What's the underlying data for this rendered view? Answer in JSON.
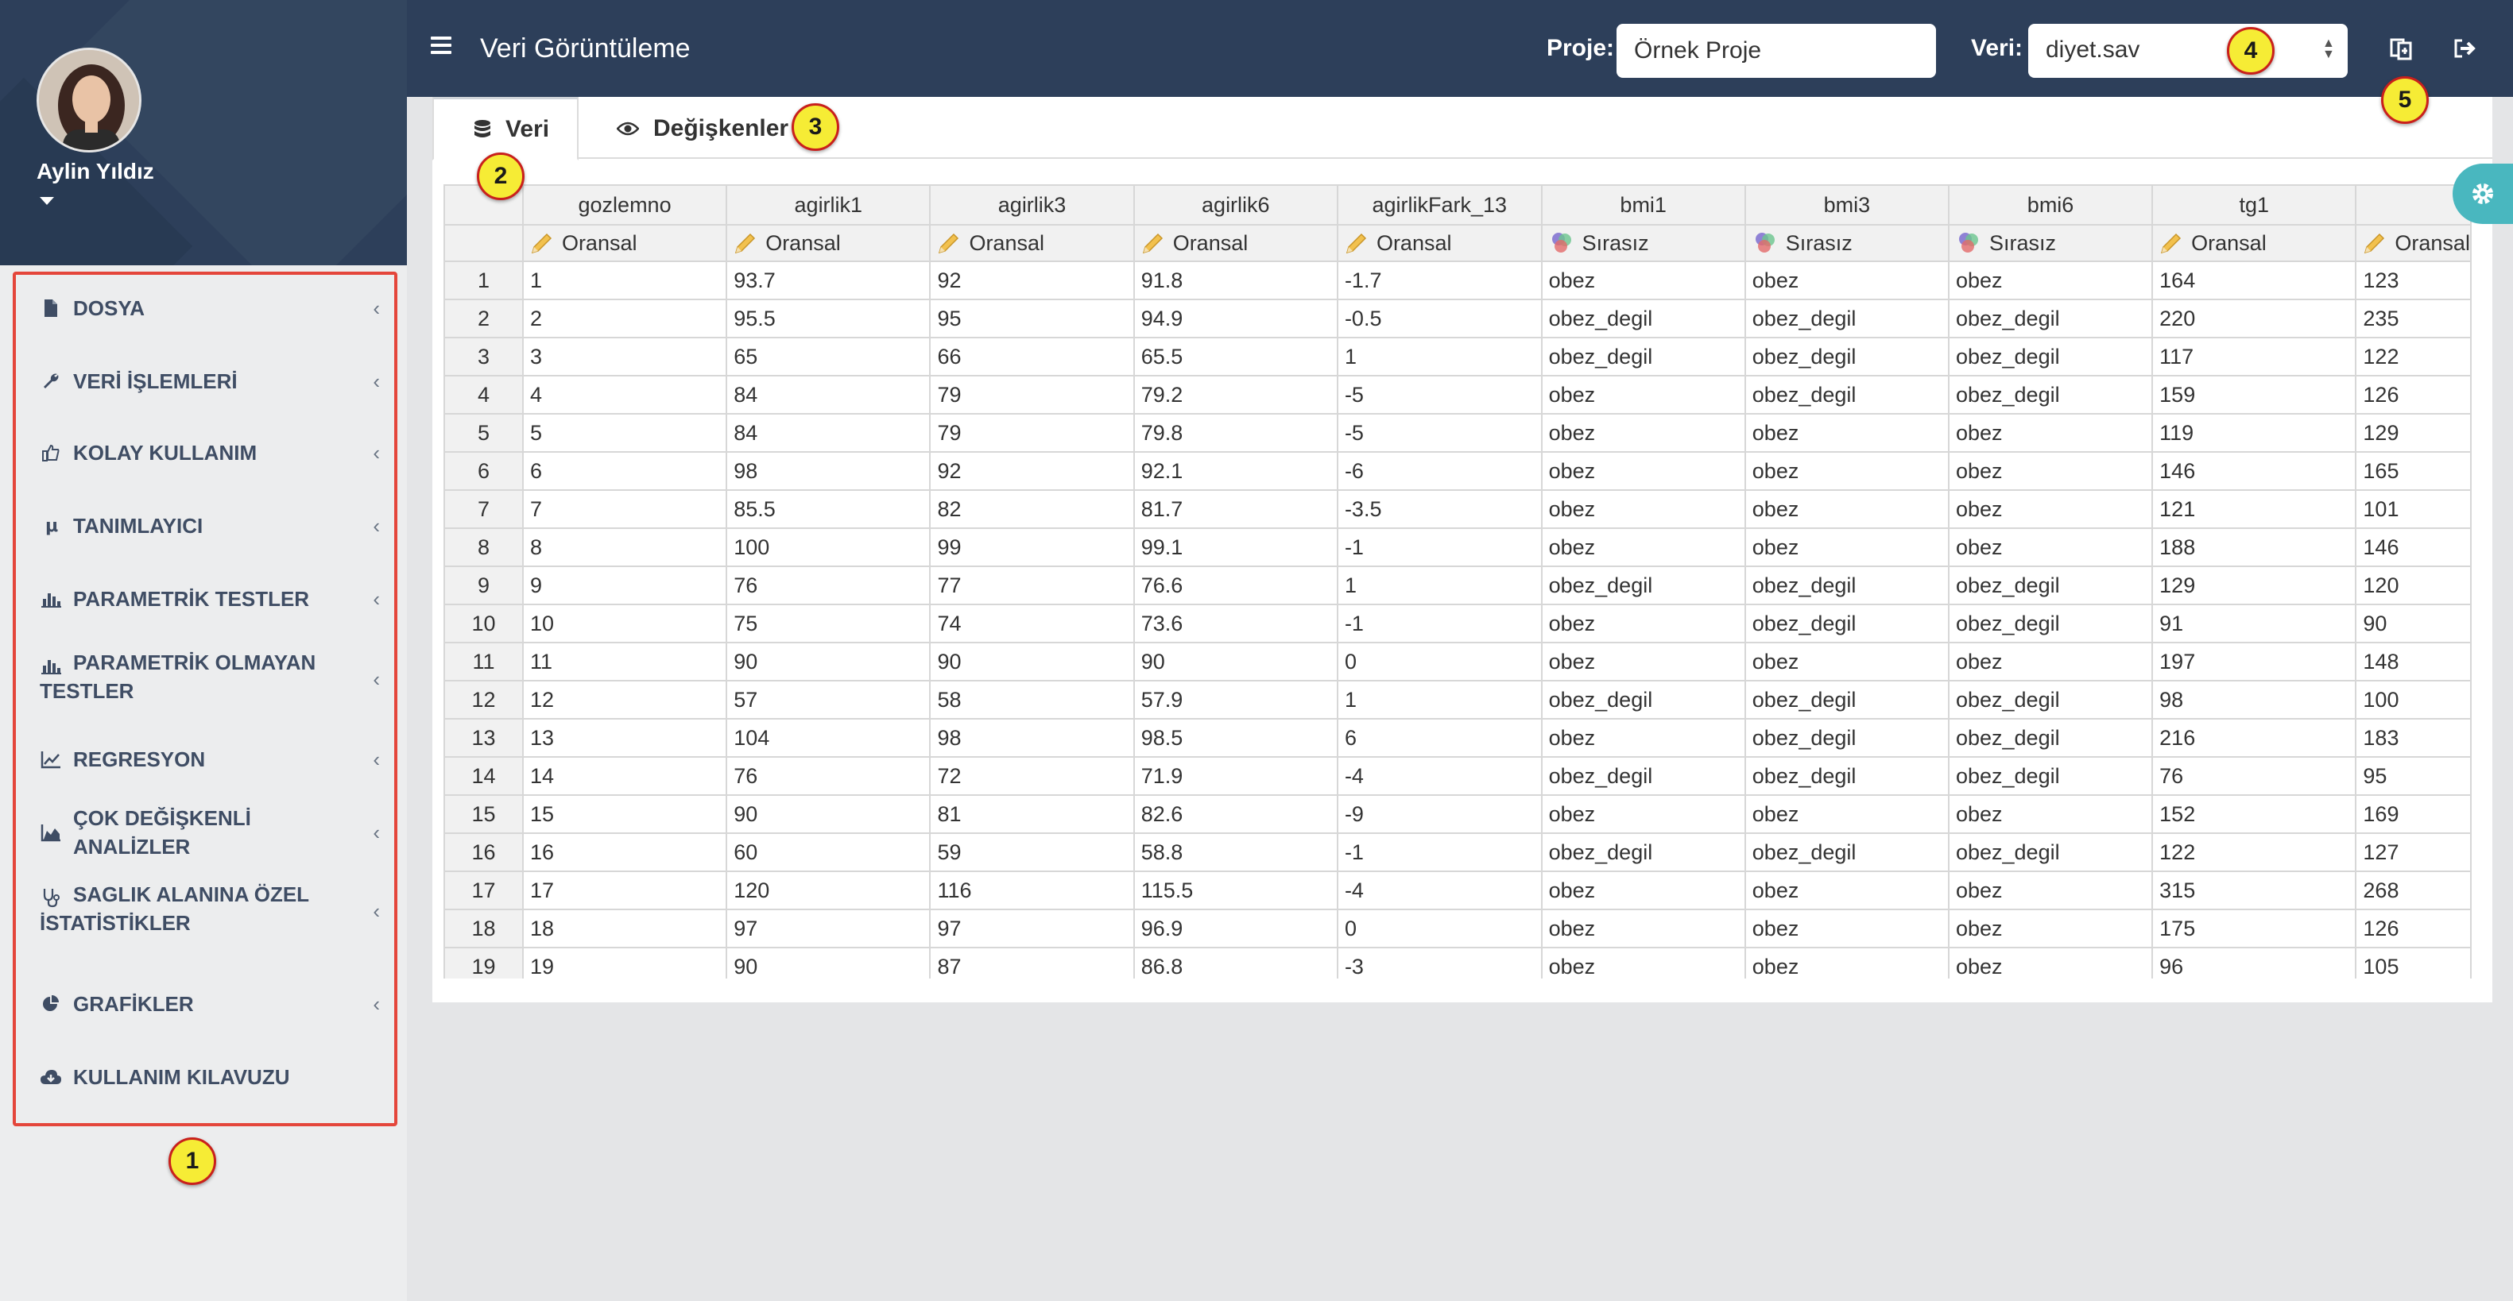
{
  "user": {
    "name": "Aylin Yıldız"
  },
  "sidebar": {
    "items": [
      {
        "label": "DOSYA",
        "icon": "file-icon"
      },
      {
        "label": "VERİ İŞLEMLERİ",
        "icon": "wrench-icon"
      },
      {
        "label": "KOLAY KULLANIM",
        "icon": "thumbs-up-icon"
      },
      {
        "label": "TANIMLAYICI",
        "icon": "mu-icon"
      },
      {
        "label": "PARAMETRİK TESTLER",
        "icon": "bar-chart-icon"
      },
      {
        "label": "PARAMETRİK OLMAYAN TESTLER",
        "icon": "bar-chart-icon"
      },
      {
        "label": "REGRESYON",
        "icon": "line-chart-icon"
      },
      {
        "label": "ÇOK DEĞİŞKENLİ ANALİZLER",
        "icon": "area-chart-icon"
      },
      {
        "label": "SAGLIK ALANINA ÖZEL İSTATİSTİKLER",
        "icon": "stethoscope-icon"
      },
      {
        "label": "GRAFİKLER",
        "icon": "pie-chart-icon"
      },
      {
        "label": "KULLANIM KILAVUZU",
        "icon": "cloud-download-icon"
      }
    ]
  },
  "topbar": {
    "title": "Veri Görüntüleme",
    "proje_label": "Proje:",
    "proje_value": "Örnek Proje",
    "veri_label": "Veri:",
    "veri_value": "diyet.sav"
  },
  "tabs": [
    {
      "label": "Veri",
      "icon": "database-icon"
    },
    {
      "label": "Değişkenler",
      "icon": "eye-icon"
    }
  ],
  "badges": [
    "1",
    "2",
    "3",
    "4",
    "5"
  ],
  "table": {
    "columns": [
      "gozlemno",
      "agirlik1",
      "agirlik3",
      "agirlik6",
      "agirlikFark_13",
      "bmi1",
      "bmi3",
      "bmi6",
      "tg1",
      ""
    ],
    "types": [
      "Oransal",
      "Oransal",
      "Oransal",
      "Oransal",
      "Oransal",
      "Sırasız",
      "Sırasız",
      "Sırasız",
      "Oransal",
      "Oransal"
    ],
    "rows": [
      [
        "1",
        "1",
        "93.7",
        "92",
        "91.8",
        "-1.7",
        "obez",
        "obez",
        "obez",
        "164",
        "123"
      ],
      [
        "2",
        "2",
        "95.5",
        "95",
        "94.9",
        "-0.5",
        "obez_degil",
        "obez_degil",
        "obez_degil",
        "220",
        "235"
      ],
      [
        "3",
        "3",
        "65",
        "66",
        "65.5",
        "1",
        "obez_degil",
        "obez_degil",
        "obez_degil",
        "117",
        "122"
      ],
      [
        "4",
        "4",
        "84",
        "79",
        "79.2",
        "-5",
        "obez",
        "obez_degil",
        "obez_degil",
        "159",
        "126"
      ],
      [
        "5",
        "5",
        "84",
        "79",
        "79.8",
        "-5",
        "obez",
        "obez",
        "obez",
        "119",
        "129"
      ],
      [
        "6",
        "6",
        "98",
        "92",
        "92.1",
        "-6",
        "obez",
        "obez",
        "obez",
        "146",
        "165"
      ],
      [
        "7",
        "7",
        "85.5",
        "82",
        "81.7",
        "-3.5",
        "obez",
        "obez",
        "obez",
        "121",
        "101"
      ],
      [
        "8",
        "8",
        "100",
        "99",
        "99.1",
        "-1",
        "obez",
        "obez",
        "obez",
        "188",
        "146"
      ],
      [
        "9",
        "9",
        "76",
        "77",
        "76.6",
        "1",
        "obez_degil",
        "obez_degil",
        "obez_degil",
        "129",
        "120"
      ],
      [
        "10",
        "10",
        "75",
        "74",
        "73.6",
        "-1",
        "obez",
        "obez_degil",
        "obez_degil",
        "91",
        "90"
      ],
      [
        "11",
        "11",
        "90",
        "90",
        "90",
        "0",
        "obez",
        "obez",
        "obez",
        "197",
        "148"
      ],
      [
        "12",
        "12",
        "57",
        "58",
        "57.9",
        "1",
        "obez_degil",
        "obez_degil",
        "obez_degil",
        "98",
        "100"
      ],
      [
        "13",
        "13",
        "104",
        "98",
        "98.5",
        "6",
        "obez",
        "obez_degil",
        "obez_degil",
        "216",
        "183"
      ],
      [
        "14",
        "14",
        "76",
        "72",
        "71.9",
        "-4",
        "obez_degil",
        "obez_degil",
        "obez_degil",
        "76",
        "95"
      ],
      [
        "15",
        "15",
        "90",
        "81",
        "82.6",
        "-9",
        "obez",
        "obez",
        "obez",
        "152",
        "169"
      ],
      [
        "16",
        "16",
        "60",
        "59",
        "58.8",
        "-1",
        "obez_degil",
        "obez_degil",
        "obez_degil",
        "122",
        "127"
      ],
      [
        "17",
        "17",
        "120",
        "116",
        "115.5",
        "-4",
        "obez",
        "obez",
        "obez",
        "315",
        "268"
      ],
      [
        "18",
        "18",
        "97",
        "97",
        "96.9",
        "0",
        "obez",
        "obez",
        "obez",
        "175",
        "126"
      ],
      [
        "19",
        "19",
        "90",
        "87",
        "86.8",
        "-3",
        "obez",
        "obez",
        "obez",
        "96",
        "105"
      ]
    ]
  },
  "colors": {
    "header_bg": "#2d3f5a",
    "sidebar_bg": "#ecedee",
    "highlight_border": "#e4463b",
    "badge_fill": "#f6ec35",
    "settings_accent": "#49b7bf"
  }
}
